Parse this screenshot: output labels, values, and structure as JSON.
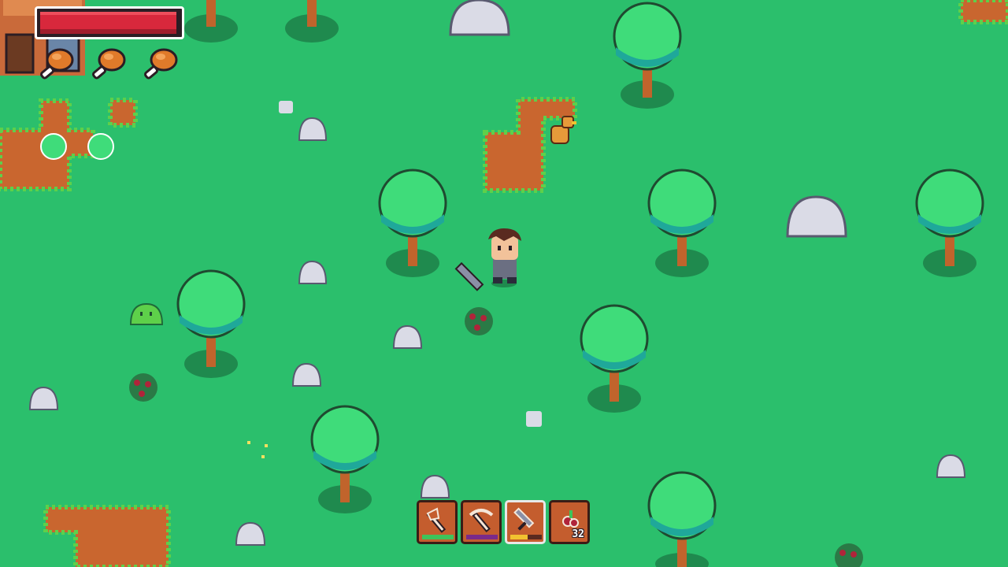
{
  "player": {
    "health": 0.97,
    "hunger_icons": 3
  },
  "hotbar": {
    "selected_index": 2,
    "slots": [
      {
        "item": "axe-icon",
        "durability": 1.0,
        "dur_color": "#3ec35a"
      },
      {
        "item": "pickaxe-icon",
        "durability": 1.0,
        "dur_color": "#7a2a8a"
      },
      {
        "item": "sword-icon",
        "durability": 0.55,
        "dur_color": "#f2c230"
      },
      {
        "item": "berries-icon",
        "count": "32"
      }
    ]
  },
  "colors": {
    "grass": "#2bbf6c",
    "dirt": "#c9662f",
    "tree_canopy": "#3fdc7a",
    "tree_trunk": "#c0642c",
    "rock": "#dadbe6",
    "health_fill": "#d8283c"
  }
}
